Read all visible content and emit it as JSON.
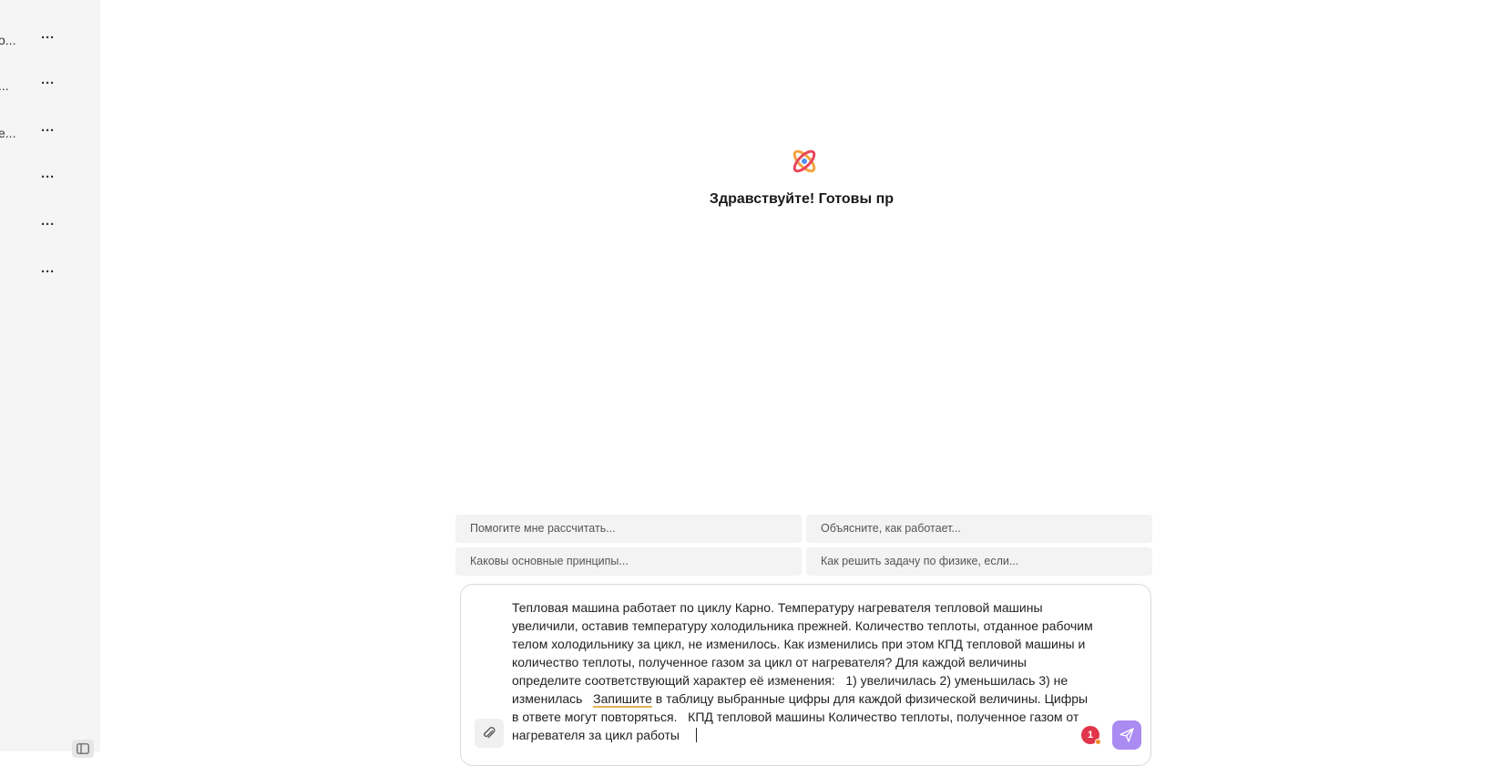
{
  "sidebar": {
    "history": [
      {
        "title": "о...",
        "menu": "···"
      },
      {
        "title": "...",
        "menu": "···"
      },
      {
        "title": "е...",
        "menu": "···"
      },
      {
        "title": "",
        "menu": "···"
      },
      {
        "title": "",
        "menu": "···"
      },
      {
        "title": "",
        "menu": "···"
      }
    ]
  },
  "main": {
    "greeting": "Здравствуйте! Готовы пр",
    "suggestions": [
      "Помогите мне рассчитать...",
      "Объясните, как работает...",
      "Каковы основные принципы...",
      "Как решить задачу по физике, если..."
    ]
  },
  "composer": {
    "text_before": "Тепловая машина работает по циклу Карно. Температуру нагревателя тепловой машины увеличили, оставив температуру холодильника прежней. Количество теплоты, отданное рабочим телом холодильнику за цикл, не изменилось. Как изменились при этом КПД тепловой машины и количество теплоты, полученное газом за цикл от нагревателя? Для каждой величины определите соответствующий характер её изменения:   1) увеличилась 2) уменьшилась 3) не изменилась   ",
    "text_highlight": "Запишите",
    "text_after": " в таблицу выбранные цифры для каждой физической величины. Цифры в ответе могут повторяться.   КПД тепловой машины Количество теплоты, полученное газом от нагревателя за цикл работы",
    "badge_count": "1"
  },
  "colors": {
    "accent": "#a98bf2",
    "badge": "#e0354a",
    "sidebar_bg": "#f5f5f5",
    "suggestion_bg": "#f3f3f3"
  },
  "icons": {
    "logo": "atom-icon",
    "attach": "paperclip-icon",
    "send": "send-icon",
    "toggle": "sidebar-toggle-icon"
  }
}
